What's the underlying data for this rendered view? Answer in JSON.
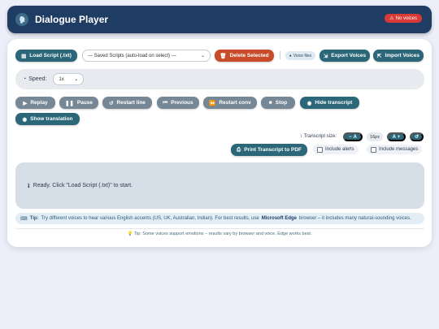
{
  "header": {
    "title": "Dialogue Player",
    "badge": "No voices",
    "logo_icon": "speaker-head-icon"
  },
  "toolbar": {
    "load_script": "Load Script (.txt)",
    "saved_scripts_select": "--- Saved Scripts (auto-load on select) ---",
    "delete_selected": "Delete Selected",
    "voice_files": "Voice files",
    "export_voices": "Export Voices",
    "import_voices": "Import Voices"
  },
  "speed": {
    "label": "Speed:",
    "value": "1x"
  },
  "controls": {
    "replay": "Replay",
    "pause": "Pause",
    "restart_line": "Restart line",
    "previous": "Previous",
    "restart_conv": "Restart conv",
    "stop": "Stop",
    "hide_transcript": "Hide transcript",
    "show_translation": "Show translation"
  },
  "transcript": {
    "size_label": "Transcript size:",
    "decrease": "A",
    "size_value": "16px",
    "increase": "A",
    "print_pdf": "Print Transcript to PDF",
    "include_alerts": "Include alerts",
    "include_messages": "Include messages"
  },
  "status": {
    "text": "Ready. Click \"Load Script (.txt)\" to start."
  },
  "tip": {
    "label": "Tip:",
    "text_before": "Try different voices to hear various English accents (US, UK, Australian, Indian). For best results, use",
    "highlight": "Microsoft Edge",
    "text_after": "browser – it includes many natural-sounding voices."
  },
  "footer": {
    "tip": "Tip: Some voices support emotions – results vary by browser and voice. Edge works best."
  },
  "colors": {
    "header_bg": "#1f3c62",
    "teal": "#2b6779",
    "gray": "#768796",
    "red": "#c94c2a",
    "badge_red": "#d93a36"
  }
}
